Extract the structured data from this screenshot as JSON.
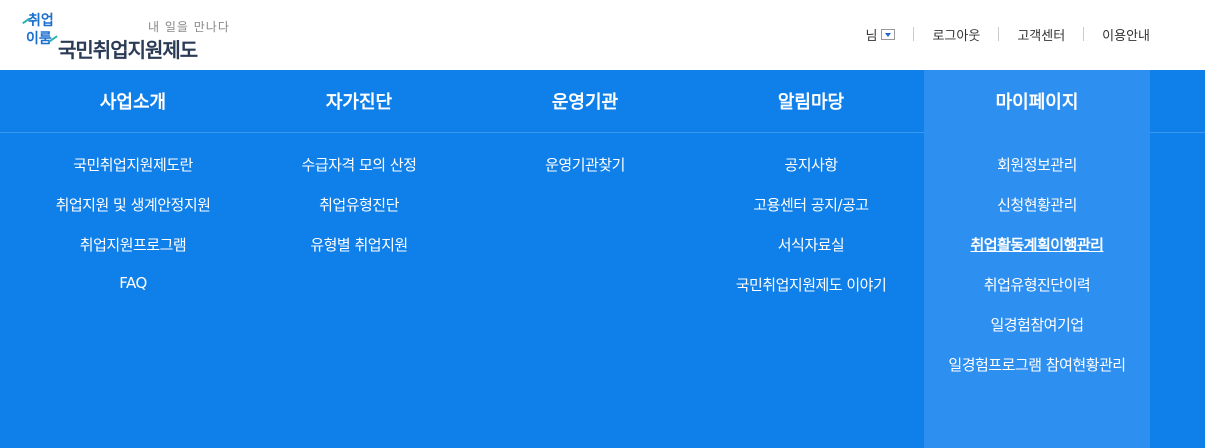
{
  "header": {
    "logo": {
      "mark_top": "취업",
      "mark_bottom": "이룸",
      "slogan": "내 일을 만나다",
      "name": "국민취업지원제도"
    },
    "util": {
      "user_suffix": "님",
      "logout": "로그아웃",
      "support": "고객센터",
      "guide": "이용안내"
    }
  },
  "gnb": {
    "menus": [
      {
        "label": "사업소개",
        "items": [
          "국민취업지원제도란",
          "취업지원 및 생계안정지원",
          "취업지원프로그램",
          "FAQ"
        ]
      },
      {
        "label": "자가진단",
        "items": [
          "수급자격 모의 산정",
          "취업유형진단",
          "유형별 취업지원"
        ]
      },
      {
        "label": "운영기관",
        "items": [
          "운영기관찾기"
        ]
      },
      {
        "label": "알림마당",
        "items": [
          "공지사항",
          "고용센터 공지/공고",
          "서식자료실",
          "국민취업지원제도 이야기"
        ]
      },
      {
        "label": "마이페이지",
        "items": [
          "회원정보관리",
          "신청현황관리",
          "취업활동계획이행관리",
          "취업유형진단이력",
          "일경험참여기업",
          "일경험프로그램 참여현황관리"
        ]
      }
    ]
  },
  "colors": {
    "menu_bg": "#0f7fe9",
    "menu_active_bg": "#2d8ff0",
    "brand_text": "#2b3a55"
  }
}
